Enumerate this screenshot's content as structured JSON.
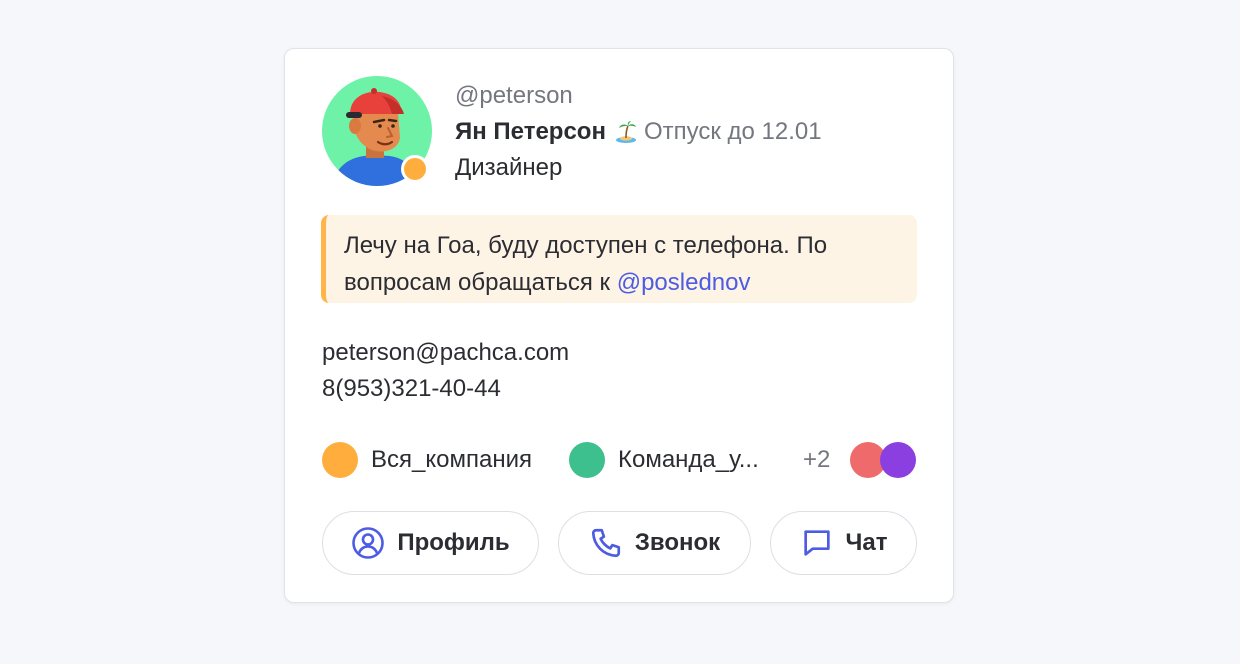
{
  "user": {
    "username": "@peterson",
    "name": "Ян Петерсон",
    "vacation": "Отпуск до 12.01",
    "role": "Дизайнер",
    "status_color": "#ffae3d"
  },
  "note": {
    "text": "Лечу на Гоа, буду доступен с телефона. По вопросам обращаться к ",
    "mention": "@poslednov"
  },
  "contacts": {
    "email": "peterson@pachca.com",
    "phone": "8(953)321-40-44"
  },
  "groups": {
    "items": [
      {
        "label": "Вся_компания",
        "color": "#ffae3d"
      },
      {
        "label": "Команда_у...",
        "color": "#3ebf8e"
      }
    ],
    "more": "+2",
    "extra_colors": [
      "#ef6b6b",
      "#8b3fe0"
    ]
  },
  "actions": {
    "profile": "Профиль",
    "call": "Звонок",
    "chat": "Чат"
  },
  "icons": {
    "vacation": "palm-island-icon",
    "profile": "user-circle-icon",
    "call": "phone-icon",
    "chat": "chat-bubble-icon"
  },
  "colors": {
    "accent": "#4c5ce3",
    "note_bg": "#fef4e6",
    "note_border": "#ffb54a"
  }
}
